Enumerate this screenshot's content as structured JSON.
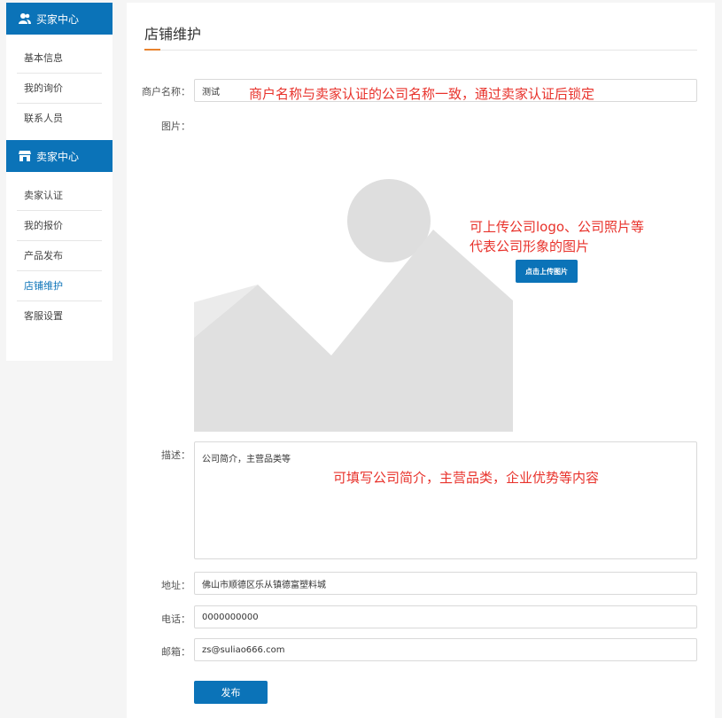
{
  "sidebar": {
    "buyer_header": "买家中心",
    "buyer_items": [
      "基本信息",
      "我的询价",
      "联系人员"
    ],
    "seller_header": "卖家中心",
    "seller_items": [
      "卖家认证",
      "我的报价",
      "产品发布",
      "店铺维护",
      "客服设置"
    ],
    "active_item": "店铺维护"
  },
  "page": {
    "title": "店铺维护"
  },
  "form": {
    "merchant_name_label": "商户名称：",
    "merchant_name_value": "测试",
    "image_label": "图片：",
    "upload_button": "点击上传图片",
    "description_label": "描述：",
    "description_value": "公司简介，主营品类等",
    "address_label": "地址：",
    "address_value": "佛山市顺德区乐从镇德富塑料城",
    "phone_label": "电话：",
    "phone_value": "0000000000",
    "email_label": "邮箱：",
    "email_value": "zs@suliao666.com",
    "publish_button": "发布"
  },
  "annotations": {
    "merchant_name_note": "商户名称与卖家认证的公司名称一致，通过卖家认证后锁定",
    "image_note_line1": "可上传公司logo、公司照片等",
    "image_note_line2": "代表公司形象的图片",
    "description_note": "可填写公司简介，主营品类，企业优势等内容"
  },
  "colors": {
    "primary": "#0b73b8",
    "accent": "#e8822d",
    "note": "#e8322b"
  }
}
